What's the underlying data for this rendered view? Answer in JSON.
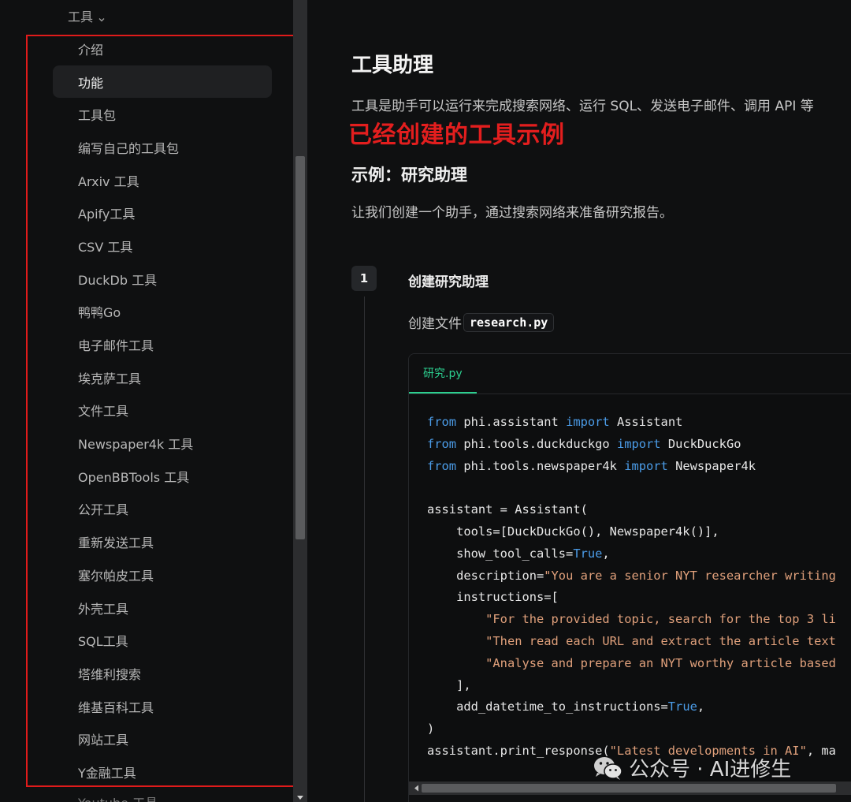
{
  "sidebar": {
    "section_title": "工具",
    "items": [
      {
        "label": "介绍",
        "active": false
      },
      {
        "label": "功能",
        "active": true
      },
      {
        "label": "工具包",
        "active": false
      },
      {
        "label": "编写自己的工具包",
        "active": false
      },
      {
        "label": "Arxiv 工具",
        "active": false
      },
      {
        "label": "Apify工具",
        "active": false
      },
      {
        "label": "CSV 工具",
        "active": false
      },
      {
        "label": "DuckDb 工具",
        "active": false
      },
      {
        "label": "鸭鸭Go",
        "active": false
      },
      {
        "label": "电子邮件工具",
        "active": false
      },
      {
        "label": "埃克萨工具",
        "active": false
      },
      {
        "label": "文件工具",
        "active": false
      },
      {
        "label": "Newspaper4k 工具",
        "active": false
      },
      {
        "label": "OpenBBTools 工具",
        "active": false
      },
      {
        "label": "公开工具",
        "active": false
      },
      {
        "label": "重新发送工具",
        "active": false
      },
      {
        "label": "塞尔帕皮工具",
        "active": false
      },
      {
        "label": "外壳工具",
        "active": false
      },
      {
        "label": "SQL工具",
        "active": false
      },
      {
        "label": "塔维利搜索",
        "active": false
      },
      {
        "label": "维基百科工具",
        "active": false
      },
      {
        "label": "网站工具",
        "active": false
      },
      {
        "label": "Y金融工具",
        "active": false
      }
    ],
    "partial_item": "Youtube 工具"
  },
  "main": {
    "title": "工具助理",
    "intro": "工具是助手可以运行来完成搜索网络、运行 SQL、发送电子邮件、调用 API 等",
    "annotation": "已经创建的工具示例",
    "example_heading": "示例：研究助理",
    "example_desc": "让我们创建一个助手，通过搜索网络来准备研究报告。",
    "step": {
      "number": "1",
      "title": "创建研究助理",
      "create_file_prefix": "创建文件",
      "filename": "research.py"
    },
    "code": {
      "tab_label": "研究.py"
    }
  },
  "watermark": {
    "text": "公众号 · AI进修生"
  },
  "colors": {
    "background": "#0f1011",
    "accent_green": "#2ccf8f",
    "annotation_red": "#e31e1e",
    "keyword_blue": "#4b9ce8",
    "string_orange": "#e0a07b"
  }
}
